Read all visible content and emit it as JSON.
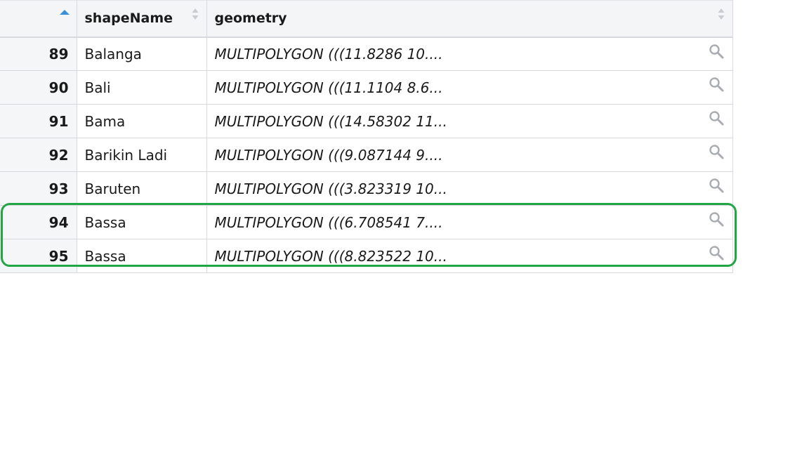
{
  "table": {
    "sort_column": "index",
    "sort_direction": "ascending",
    "columns": [
      {
        "key": "index",
        "label": ""
      },
      {
        "key": "shapeName",
        "label": "shapeName"
      },
      {
        "key": "geometry",
        "label": "geometry"
      }
    ],
    "rows": [
      {
        "index": "89",
        "shapeName": "Balanga",
        "geometry": "MULTIPOLYGON (((11.8286 10...."
      },
      {
        "index": "90",
        "shapeName": "Bali",
        "geometry": "MULTIPOLYGON (((11.1104 8.6..."
      },
      {
        "index": "91",
        "shapeName": "Bama",
        "geometry": "MULTIPOLYGON (((14.58302 11..."
      },
      {
        "index": "92",
        "shapeName": "Barikin Ladi",
        "geometry": "MULTIPOLYGON (((9.087144 9...."
      },
      {
        "index": "93",
        "shapeName": "Baruten",
        "geometry": "MULTIPOLYGON (((3.823319 10..."
      },
      {
        "index": "94",
        "shapeName": "Bassa",
        "geometry": "MULTIPOLYGON (((6.708541 7...."
      },
      {
        "index": "95",
        "shapeName": "Bassa",
        "geometry": "MULTIPOLYGON (((8.823522 10..."
      }
    ]
  },
  "highlight": {
    "color": "#22a645",
    "rows": [
      "94",
      "95"
    ]
  },
  "colors": {
    "header_bg": "#f4f5f7",
    "index_bg": "#f4f6f8",
    "border": "#d6d9dd",
    "sort_active": "#3a8fd9",
    "sort_inactive": "#c9cdd2",
    "magnifier": "#a9adb2"
  },
  "icons": {
    "sort_active": "sort-ascending-icon",
    "sort_inactive": "sort-both-icon",
    "cell_view": "magnifier-icon"
  }
}
